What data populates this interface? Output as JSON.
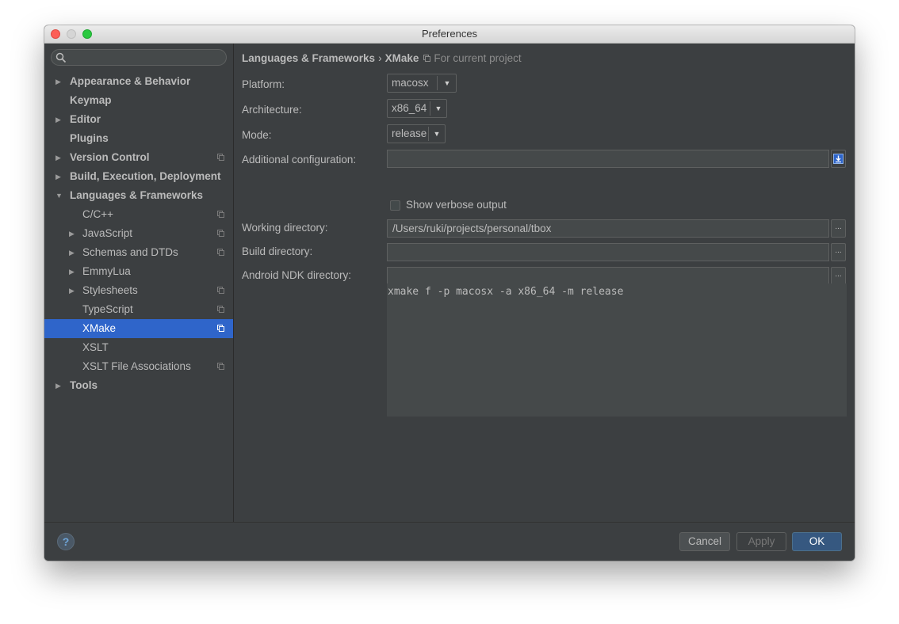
{
  "window": {
    "title": "Preferences"
  },
  "search": {
    "placeholder": ""
  },
  "sidebar": {
    "items": [
      {
        "label": "Appearance & Behavior"
      },
      {
        "label": "Keymap"
      },
      {
        "label": "Editor"
      },
      {
        "label": "Plugins"
      },
      {
        "label": "Version Control"
      },
      {
        "label": "Build, Execution, Deployment"
      },
      {
        "label": "Languages & Frameworks"
      },
      {
        "label": "C/C++"
      },
      {
        "label": "JavaScript"
      },
      {
        "label": "Schemas and DTDs"
      },
      {
        "label": "EmmyLua"
      },
      {
        "label": "Stylesheets"
      },
      {
        "label": "TypeScript"
      },
      {
        "label": "XMake"
      },
      {
        "label": "XSLT"
      },
      {
        "label": "XSLT File Associations"
      },
      {
        "label": "Tools"
      }
    ],
    "selected": "XMake"
  },
  "breadcrumb": {
    "parent": "Languages & Frameworks",
    "separator": "›",
    "current": "XMake",
    "note": "For current project"
  },
  "form": {
    "platform_label": "Platform:",
    "platform_value": "macosx",
    "architecture_label": "Architecture:",
    "architecture_value": "x86_64",
    "mode_label": "Mode:",
    "mode_value": "release",
    "additional_label": "Additional configuration:",
    "additional_value": "",
    "verbose_label": "Show verbose output",
    "verbose_checked": false,
    "working_dir_label": "Working directory:",
    "working_dir_value": "/Users/ruki/projects/personal/tbox",
    "build_dir_label": "Build directory:",
    "build_dir_value": "",
    "ndk_dir_label": "Android NDK directory:",
    "ndk_dir_value": "",
    "browse_label": "...",
    "command_preview": "xmake f -p macosx -a x86_64 -m release"
  },
  "footer": {
    "help_label": "?",
    "cancel_label": "Cancel",
    "apply_label": "Apply",
    "ok_label": "OK"
  },
  "colors": {
    "selection": "#2f65ca",
    "background": "#3c3f41",
    "ok_button": "#365880"
  }
}
